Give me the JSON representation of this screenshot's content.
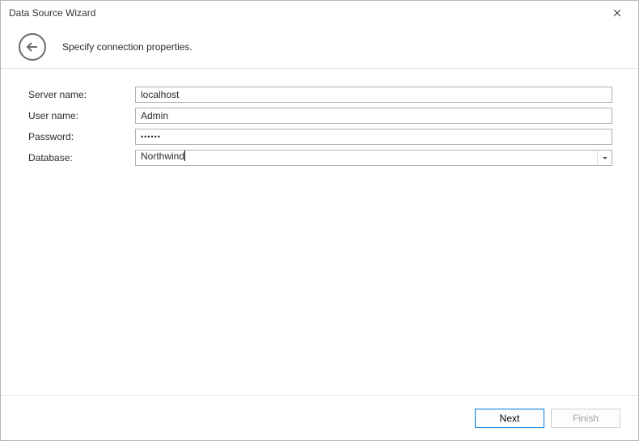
{
  "window": {
    "title": "Data Source Wizard"
  },
  "header": {
    "subtitle": "Specify connection properties."
  },
  "form": {
    "server_name_label": "Server name:",
    "server_name_value": "localhost",
    "user_name_label": "User name:",
    "user_name_value": "Admin",
    "password_label": "Password:",
    "password_value": "••••••",
    "database_label": "Database:",
    "database_value": "Northwind"
  },
  "footer": {
    "next_label": "Next",
    "finish_label": "Finish"
  }
}
